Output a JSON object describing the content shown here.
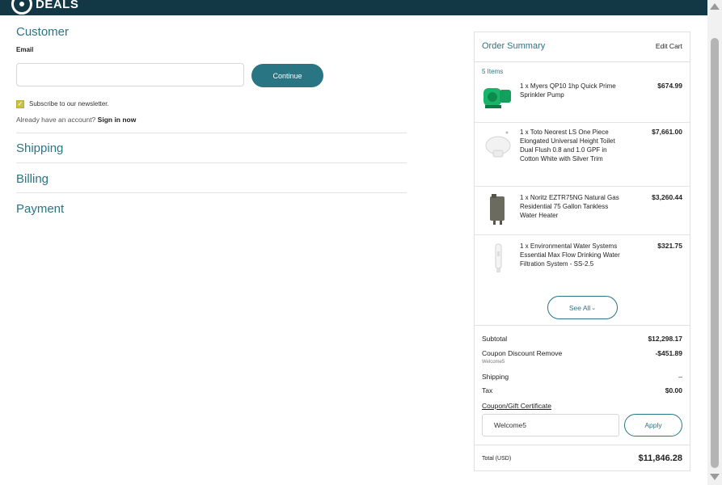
{
  "header": {
    "logo_text": "DEALS"
  },
  "checkout": {
    "customer": {
      "title": "Customer",
      "email_label": "Email",
      "email_value": "",
      "continue_label": "Continue",
      "newsletter_checked": true,
      "newsletter_label": "Subscribe to our newsletter.",
      "account_prompt": "Already have an account?",
      "signin_label": "Sign in now"
    },
    "shipping_title": "Shipping",
    "billing_title": "Billing",
    "payment_title": "Payment"
  },
  "order_summary": {
    "title": "Order Summary",
    "edit_cart_label": "Edit Cart",
    "items_count": "5 Items",
    "items": [
      {
        "name": "1 x Myers QP10 1hp Quick Prime Sprinkler Pump",
        "price": "$674.99",
        "icon": "pump-icon"
      },
      {
        "name": "1 x Toto Neorest LS One Piece Elongated Universal Height Toilet Dual Flush 0.8 and 1.0 GPF in Cotton White with Silver Trim",
        "price": "$7,661.00",
        "icon": "toilet-icon"
      },
      {
        "name": "1 x Noritz EZTR75NG Natural Gas Residential 75 Gallon Tankless Water Heater",
        "price": "$3,260.44",
        "icon": "water-heater-icon"
      },
      {
        "name": "1 x Environmental Water Systems Essential Max Flow Drinking Water Filtration System - SS-2.5",
        "price": "$321.75",
        "icon": "water-filter-icon"
      }
    ],
    "see_all_label": "See All",
    "subtotal_label": "Subtotal",
    "subtotal_value": "$12,298.17",
    "coupon_discount_label": "Coupon Discount Remove",
    "coupon_discount_value": "-$451.89",
    "coupon_code_applied": "Welcome5",
    "shipping_label": "Shipping",
    "shipping_value": "–",
    "tax_label": "Tax",
    "tax_value": "$0.00",
    "coupon_link_label": "Coupon/Gift Certificate",
    "coupon_input_value": "Welcome5",
    "apply_label": "Apply",
    "total_label": "Total (USD)",
    "total_value": "$11,846.28"
  },
  "colors": {
    "brand_dark": "#123845",
    "accent_teal": "#2a7584",
    "checkbox_yellow": "#c9c24a"
  }
}
